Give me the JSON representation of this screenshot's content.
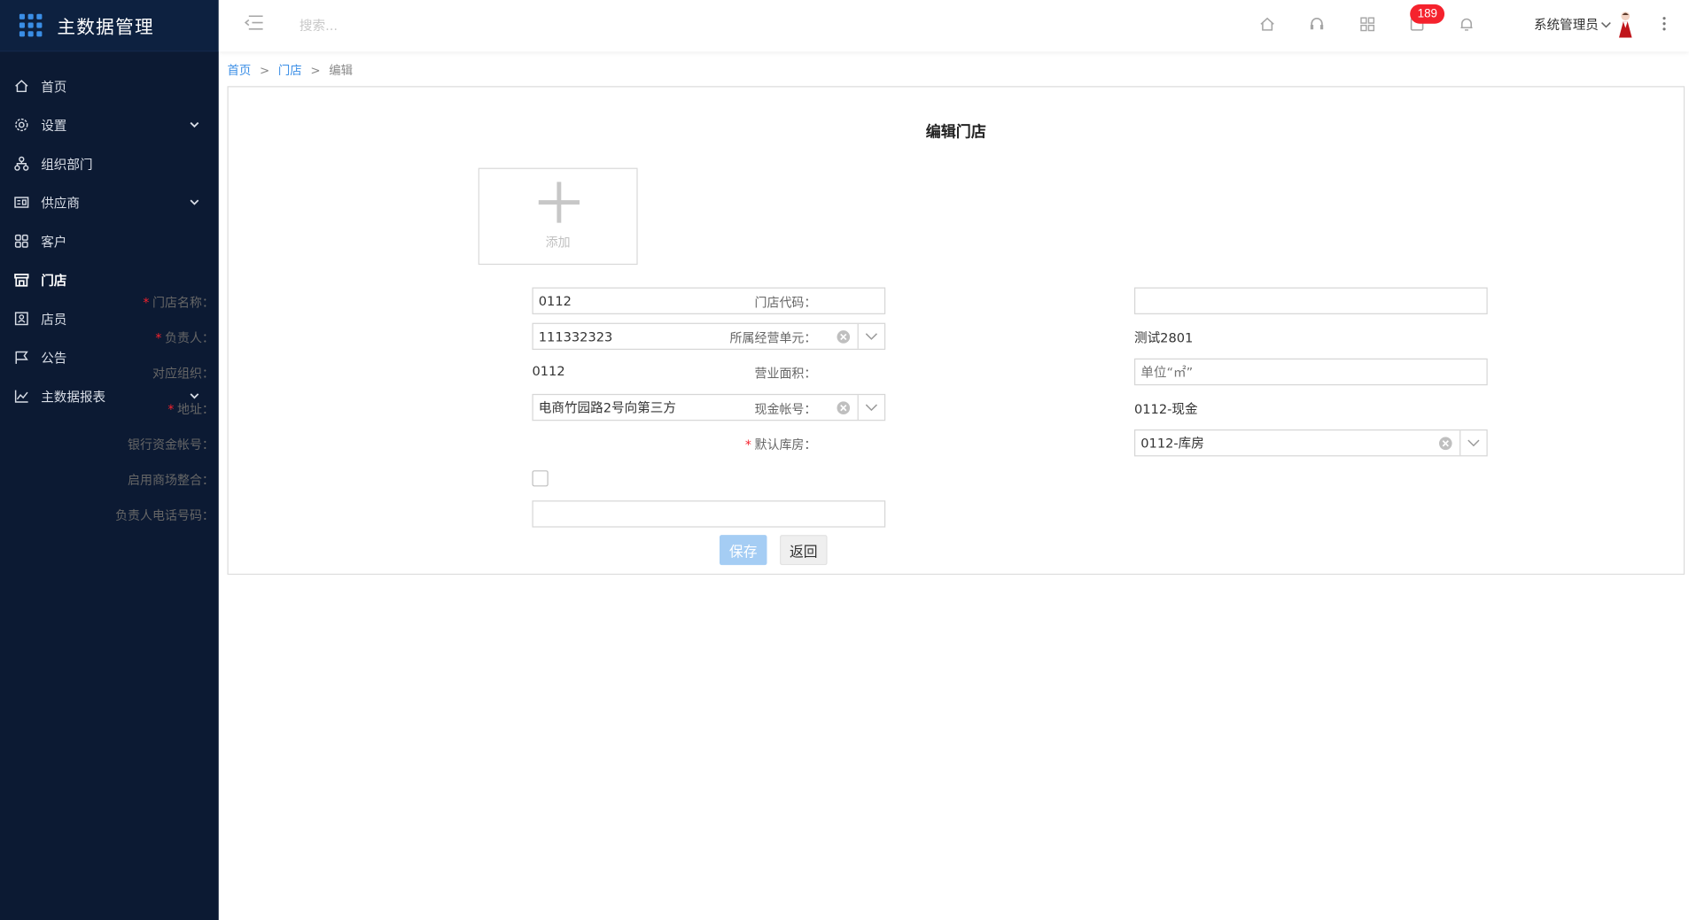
{
  "app": {
    "title": "主数据管理"
  },
  "sidebar": {
    "items": [
      {
        "label": "首页",
        "icon": "home-icon",
        "has_submenu": false,
        "active": false
      },
      {
        "label": "设置",
        "icon": "gear-icon",
        "has_submenu": true,
        "active": false
      },
      {
        "label": "组织部门",
        "icon": "org-tree-icon",
        "has_submenu": false,
        "active": false
      },
      {
        "label": "供应商",
        "icon": "supplier-card-icon",
        "has_submenu": true,
        "active": false
      },
      {
        "label": "客户",
        "icon": "customer-icon",
        "has_submenu": false,
        "active": false
      },
      {
        "label": "门店",
        "icon": "store-icon",
        "has_submenu": false,
        "active": true
      },
      {
        "label": "店员",
        "icon": "staff-badge-icon",
        "has_submenu": false,
        "active": false
      },
      {
        "label": "公告",
        "icon": "announcement-flag-icon",
        "has_submenu": false,
        "active": false
      },
      {
        "label": "主数据报表",
        "icon": "line-chart-icon",
        "has_submenu": true,
        "active": false
      }
    ]
  },
  "header": {
    "search_placeholder": "搜索...",
    "notification_count": "189",
    "user_name": "系统管理员",
    "icons": [
      "menu-toggle-icon",
      "home-icon",
      "headset-icon",
      "apps-grid-icon",
      "message-icon",
      "bell-icon",
      "user-avatar",
      "more-vertical-icon"
    ]
  },
  "breadcrumb": {
    "items": [
      "首页",
      "门店",
      "编辑"
    ],
    "separator": ">"
  },
  "form": {
    "title": "编辑门店",
    "upload_label": "添加",
    "left": {
      "store_name": {
        "label": "门店名称：",
        "required": true,
        "value": "0112"
      },
      "manager": {
        "label": "负责人：",
        "required": true,
        "value": "111332323"
      },
      "org": {
        "label": "对应组织：",
        "required": false,
        "value": "0112"
      },
      "address": {
        "label": "地址：",
        "required": true,
        "value": "电商竹园路2号向第三方"
      },
      "bank_account": {
        "label": "银行资金帐号：",
        "required": false,
        "value": ""
      },
      "mall_integration": {
        "label": "启用商场整合：",
        "required": false,
        "checked": false
      },
      "manager_phone": {
        "label": "负责人电话号码：",
        "required": false,
        "value": ""
      }
    },
    "right": {
      "store_code": {
        "label": "门店代码：",
        "required": false,
        "value": ""
      },
      "business_unit": {
        "label": "所属经营单元：",
        "required": false,
        "value": "测试2801"
      },
      "area": {
        "label": "营业面积：",
        "required": false,
        "placeholder": "单位“㎡”"
      },
      "cash_account": {
        "label": "现金帐号：",
        "required": false,
        "value": "0112-现金"
      },
      "default_warehouse": {
        "label": "默认库房：",
        "required": true,
        "value": "0112-库房"
      }
    },
    "buttons": {
      "save": "保存",
      "back": "返回"
    }
  },
  "colors": {
    "sidebar_bg": "#0c1a33",
    "accent": "#3a8ee6",
    "required": "#f5222d",
    "badge": "#f5222d",
    "save_button": "#a5cdf4"
  }
}
